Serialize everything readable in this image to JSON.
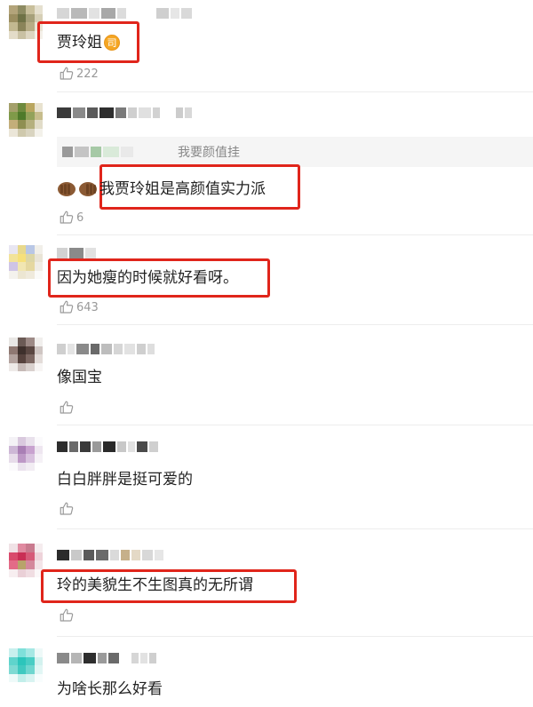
{
  "comments": [
    {
      "text": "贾玲姐",
      "badge": "司",
      "likes": "222"
    },
    {
      "quote": "我要颜值挂",
      "text": "我贾玲姐是高颜值实力派",
      "emoji": "fist-bump-emoji",
      "likes": "6"
    },
    {
      "text": "因为她瘦的时候就好看呀。",
      "likes": "643"
    },
    {
      "text": "像国宝",
      "likes": ""
    },
    {
      "text": "白白胖胖是挺可爱的",
      "likes": ""
    },
    {
      "text": "玲的美貌生不生图真的无所谓",
      "likes": ""
    },
    {
      "text": "为啥长那么好看",
      "likes": ""
    }
  ],
  "colors": {
    "highlight_box": "#e0251b",
    "badge": "#f5a623",
    "like_gray": "#999999"
  },
  "icons": {
    "like": "thumbs-up-icon"
  }
}
